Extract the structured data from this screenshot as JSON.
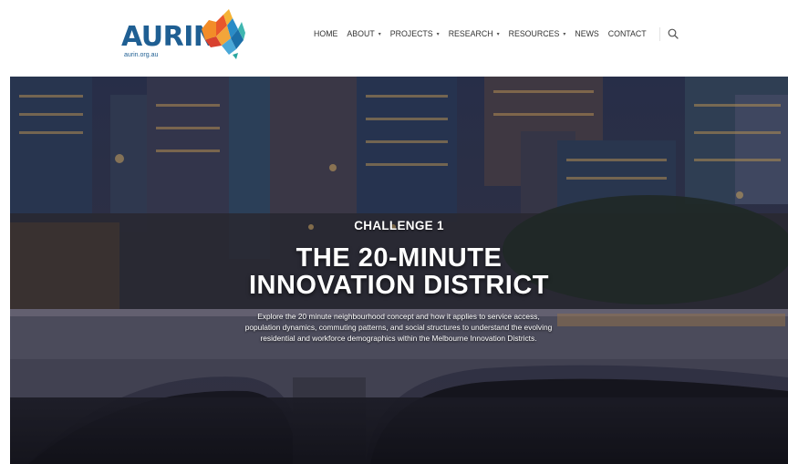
{
  "site": {
    "logo_text": "AURIN",
    "logo_sub": "aurin.org.au"
  },
  "nav": {
    "items": [
      {
        "label": "HOME",
        "dropdown": false
      },
      {
        "label": "ABOUT",
        "dropdown": true
      },
      {
        "label": "PROJECTS",
        "dropdown": true
      },
      {
        "label": "RESEARCH",
        "dropdown": true
      },
      {
        "label": "RESOURCES",
        "dropdown": true
      },
      {
        "label": "NEWS",
        "dropdown": false
      },
      {
        "label": "CONTACT",
        "dropdown": false
      }
    ],
    "caret": "▾",
    "search_icon": "search-icon"
  },
  "hero": {
    "eyebrow": "CHALLENGE 1",
    "title_line1": "THE 20-MINUTE",
    "title_line2": "INNOVATION DISTRICT",
    "desc_line1": "Explore the 20 minute neighbourhood concept and how it applies to service access,",
    "desc_line2": "population dynamics, commuting patterns, and social structures to understand the evolving",
    "desc_line3": "residential and workforce demographics within the Melbourne Innovation Districts.",
    "image": "night-city-skyline-bridge-photo"
  },
  "colors": {
    "brand_blue": "#1f5f93",
    "nav_text": "#333333",
    "hero_overlay": "#1e2030"
  }
}
